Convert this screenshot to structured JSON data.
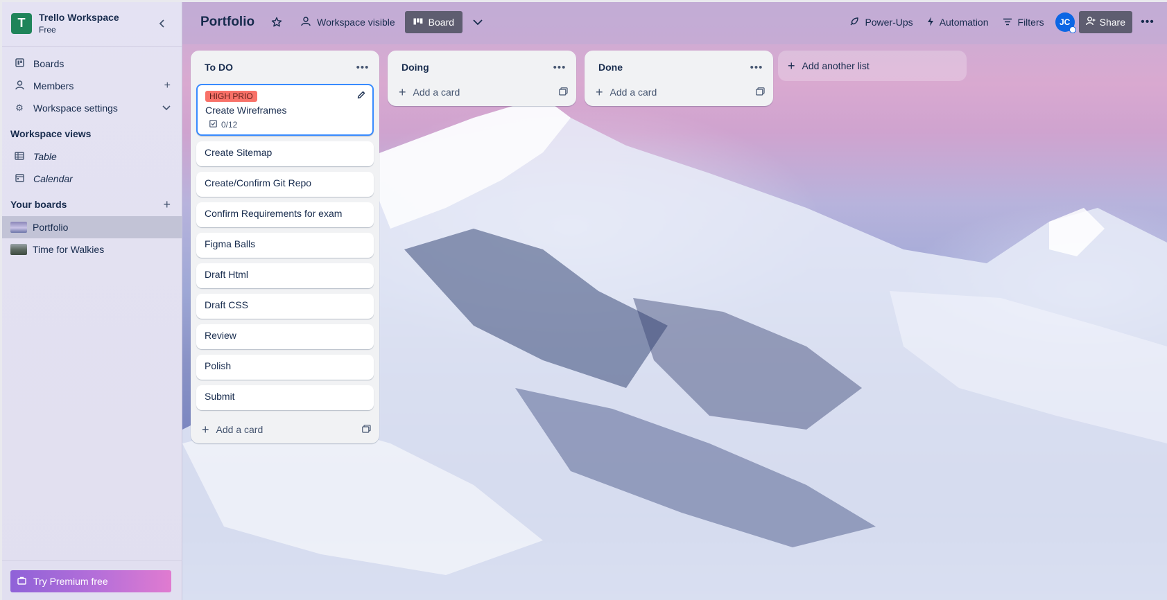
{
  "workspace": {
    "initial": "T",
    "name": "Trello Workspace",
    "plan": "Free"
  },
  "sidebar": {
    "collapse_icon": "chevron-left-icon",
    "items": [
      {
        "label": "Boards",
        "icon": "boards-icon"
      },
      {
        "label": "Members",
        "icon": "person-icon"
      },
      {
        "label": "Workspace settings",
        "icon": "gear-icon"
      }
    ],
    "views_title": "Workspace views",
    "views": [
      {
        "label": "Table",
        "icon": "table-icon"
      },
      {
        "label": "Calendar",
        "icon": "calendar-icon"
      }
    ],
    "boards_title": "Your boards",
    "boards": [
      {
        "label": "Portfolio",
        "active": true
      },
      {
        "label": "Time for Walkies",
        "active": false
      }
    ],
    "premium_label": "Try Premium free"
  },
  "header": {
    "board_title": "Portfolio",
    "visibility_label": "Workspace visible",
    "view_label": "Board",
    "powerups_label": "Power-Ups",
    "automation_label": "Automation",
    "filters_label": "Filters",
    "member_initials": "JC",
    "share_label": "Share"
  },
  "lists": [
    {
      "title": "To DO",
      "cards": [
        {
          "title": "Create Wireframes",
          "label": "HIGH PRIO",
          "checklist": "0/12"
        },
        {
          "title": "Create Sitemap"
        },
        {
          "title": "Create/Confirm Git Repo"
        },
        {
          "title": "Confirm Requirements for exam"
        },
        {
          "title": "Figma Balls"
        },
        {
          "title": "Draft Html"
        },
        {
          "title": "Draft CSS"
        },
        {
          "title": "Review"
        },
        {
          "title": "Polish"
        },
        {
          "title": "Submit"
        }
      ],
      "add_card_label": "Add a card"
    },
    {
      "title": "Doing",
      "cards": [],
      "add_card_label": "Add a card"
    },
    {
      "title": "Done",
      "cards": [],
      "add_card_label": "Add a card"
    }
  ],
  "add_list_label": "Add another list",
  "colors": {
    "accent": "#0c66e4",
    "label_red": "#f87168",
    "workspace_green": "#1f845a"
  }
}
